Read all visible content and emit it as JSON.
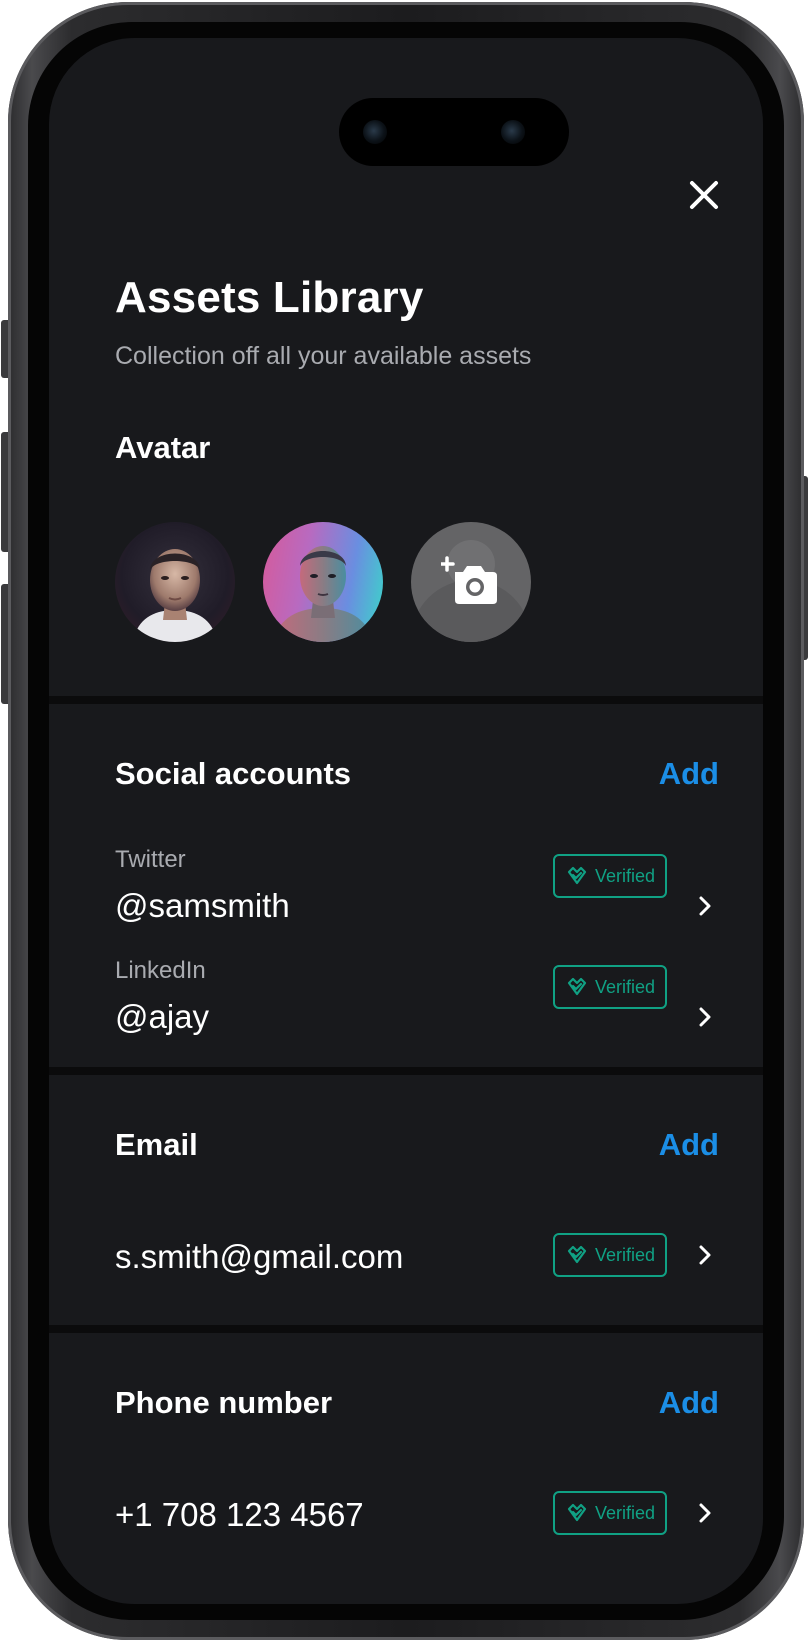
{
  "header": {
    "title": "Assets Library",
    "subtitle": "Collection off all your available assets"
  },
  "avatar_section": {
    "heading": "Avatar",
    "avatars": [
      "avatar-portrait-1",
      "avatar-portrait-2"
    ],
    "add_icon": "add-photo-camera-icon"
  },
  "social": {
    "title": "Social accounts",
    "add_label": "Add",
    "items": [
      {
        "label": "Twitter",
        "value": "@samsmith",
        "badge": "Verified"
      },
      {
        "label": "LinkedIn",
        "value": "@ajay",
        "badge": "Verified"
      }
    ]
  },
  "email": {
    "title": "Email",
    "add_label": "Add",
    "items": [
      {
        "value": "s.smith@gmail.com",
        "badge": "Verified"
      }
    ]
  },
  "phone": {
    "title": "Phone number",
    "add_label": "Add",
    "items": [
      {
        "value": "+1 708 123 4567",
        "badge": "Verified"
      }
    ]
  },
  "colors": {
    "background": "#18191c",
    "accent": "#1b8ee6",
    "verified": "#10a184",
    "text_primary": "#ffffff",
    "text_secondary": "#a9abb0"
  },
  "icons": {
    "close": "close-icon",
    "verified": "verified-check-icon",
    "chevron": "chevron-right-icon"
  }
}
